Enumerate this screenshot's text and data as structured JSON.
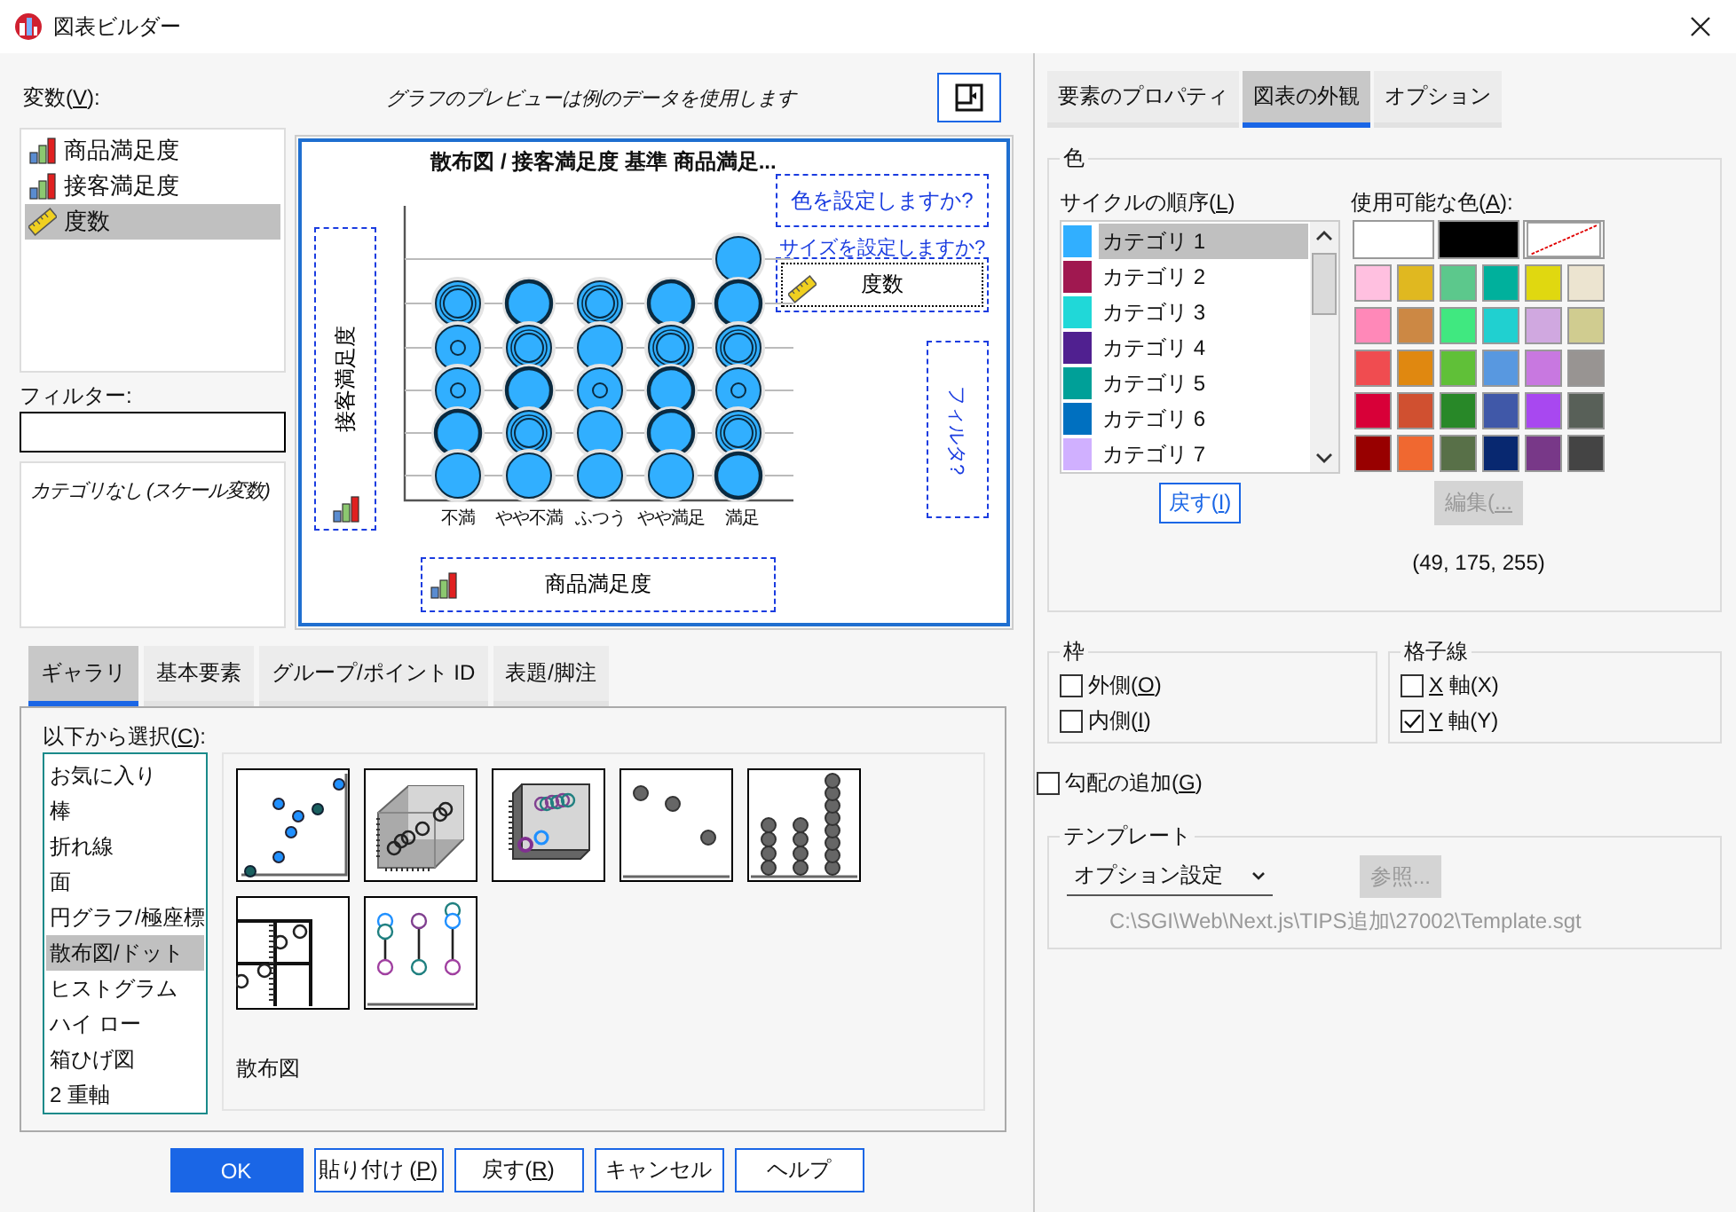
{
  "window": {
    "title": "図表ビルダー"
  },
  "variables": {
    "label": {
      "pre": "変数(",
      "key": "V",
      "post": "):"
    },
    "items": [
      {
        "name": "商品満足度",
        "kind": "ordinal",
        "selected": false
      },
      {
        "name": "接客満足度",
        "kind": "ordinal",
        "selected": false
      },
      {
        "name": "度数",
        "kind": "scale",
        "selected": true
      }
    ]
  },
  "preview_note": "グラフのプレビューは例のデータを使用します",
  "filter": {
    "label": "フィルター:"
  },
  "category_info": "カテゴリなし (スケール変数)",
  "preview": {
    "title": "散布図 / 接客満足度 基準 商品満足...",
    "y_axis": {
      "label": "接客満足度",
      "kind": "ordinal"
    },
    "x_axis": {
      "label": "商品満足度",
      "kind": "ordinal"
    },
    "x_labels": [
      "不満",
      "やや不満",
      "ふつう",
      "やや満足",
      "満足"
    ],
    "color_zone": "色を設定しますか?",
    "size_prompt": "サイズを設定しますか?",
    "size_zone": {
      "label": "度数",
      "kind": "scale"
    },
    "filter_zone": "フィルタ?"
  },
  "gallery_tabs": [
    {
      "label": "ギャラリ",
      "selected": true
    },
    {
      "label": "基本要素",
      "selected": false
    },
    {
      "label": "グループ/ポイント ID",
      "selected": false
    },
    {
      "label": "表題/脚注",
      "selected": false
    }
  ],
  "gallery": {
    "label": {
      "pre": "以下から選択(",
      "key": "C",
      "post": "):"
    },
    "types": [
      {
        "label": "お気に入り",
        "selected": false
      },
      {
        "label": "棒",
        "selected": false
      },
      {
        "label": "折れ線",
        "selected": false
      },
      {
        "label": "面",
        "selected": false
      },
      {
        "label": "円グラフ/極座標",
        "selected": false
      },
      {
        "label": "散布図/ドット",
        "selected": true
      },
      {
        "label": "ヒストグラム",
        "selected": false
      },
      {
        "label": "ハイ ロー",
        "selected": false
      },
      {
        "label": "箱ひげ図",
        "selected": false
      },
      {
        "label": "2 重軸",
        "selected": false
      }
    ],
    "thumbnails": [
      {
        "kind": "scatter"
      },
      {
        "kind": "scatter3d"
      },
      {
        "kind": "grouped3d"
      },
      {
        "kind": "dot"
      },
      {
        "kind": "dotstack"
      },
      {
        "kind": "matrix"
      },
      {
        "kind": "dropline"
      }
    ],
    "caption": "散布図"
  },
  "buttons": [
    {
      "label": "OK",
      "kind": "default"
    },
    {
      "label": {
        "pre": "貼り付け (",
        "key": "P",
        "post": ")"
      },
      "kind": "normal"
    },
    {
      "label": {
        "pre": "戻す(",
        "key": "R",
        "post": ")"
      },
      "kind": "normal"
    },
    {
      "label": "キャンセル",
      "kind": "normal"
    },
    {
      "label": "ヘルプ",
      "kind": "normal"
    }
  ],
  "side_tabs": [
    {
      "label": "要素のプロパティ",
      "selected": false
    },
    {
      "label": "図表の外観",
      "selected": true
    },
    {
      "label": "オプション",
      "selected": false
    }
  ],
  "color_group": {
    "title": "色",
    "cycle_label": {
      "pre": "サイクルの順序(",
      "key": "L",
      "post": ")"
    },
    "cycle": [
      {
        "name": "カテゴリ 1",
        "color": "#31afff",
        "selected": true
      },
      {
        "name": "カテゴリ 2",
        "color": "#a01850",
        "selected": false
      },
      {
        "name": "カテゴリ 3",
        "color": "#20d8d8",
        "selected": false
      },
      {
        "name": "カテゴリ 4",
        "color": "#502090",
        "selected": false
      },
      {
        "name": "カテゴリ 5",
        "color": "#00a098",
        "selected": false
      },
      {
        "name": "カテゴリ 6",
        "color": "#0070c0",
        "selected": false
      },
      {
        "name": "カテゴリ 7",
        "color": "#d0b0ff",
        "selected": false
      }
    ],
    "reset_button": {
      "pre": "戻す(",
      "key": "I",
      "post": ")"
    },
    "palette_label": {
      "pre": "使用可能な色(",
      "key": "A",
      "post": "):"
    },
    "palette_top": [
      {
        "kind": "color",
        "color": "#ffffff"
      },
      {
        "kind": "color",
        "color": "#000000"
      },
      {
        "kind": "none"
      }
    ],
    "palette": [
      {
        "color": "#ffc0e0"
      },
      {
        "color": "#e0b820"
      },
      {
        "color": "#5cc88c"
      },
      {
        "color": "#00b09c"
      },
      {
        "color": "#e0d810"
      },
      {
        "color": "#ece4d0"
      },
      {
        "color": "#ff88b8"
      },
      {
        "color": "#cc8844"
      },
      {
        "color": "#40e880"
      },
      {
        "color": "#20d0d0"
      },
      {
        "color": "#d0a8e0"
      },
      {
        "color": "#d0cc90"
      },
      {
        "color": "#f04c50"
      },
      {
        "color": "#e08810"
      },
      {
        "color": "#60c038"
      },
      {
        "color": "#5898e0"
      },
      {
        "color": "#c878e0"
      },
      {
        "color": "#989492"
      },
      {
        "color": "#d80038"
      },
      {
        "color": "#d05030"
      },
      {
        "color": "#288828"
      },
      {
        "color": "#4058a8"
      },
      {
        "color": "#a848f0"
      },
      {
        "color": "#586058"
      },
      {
        "color": "#980000"
      },
      {
        "color": "#f06830"
      },
      {
        "color": "#587048"
      },
      {
        "color": "#082870"
      },
      {
        "color": "#783888"
      },
      {
        "color": "#444444"
      }
    ],
    "edit_button": {
      "label": {
        "pre": "編集(",
        "key": "..."
      },
      "disabled": true
    },
    "current_rgb": "(49, 175, 255)"
  },
  "frame_group": {
    "title": "枠",
    "options": [
      {
        "label": {
          "pre": "外側(",
          "key": "O",
          "post": ")"
        },
        "checked": false
      },
      {
        "label": {
          "pre": "内側(",
          "key": "I",
          "post": ")"
        },
        "checked": false
      }
    ]
  },
  "grid_group": {
    "title": "格子線",
    "options": [
      {
        "label": {
          "key": "X",
          "post": " 軸(X)"
        },
        "checked": false
      },
      {
        "label": {
          "key": "Y",
          "post": " 軸(Y)"
        },
        "checked": true
      }
    ]
  },
  "gradient": {
    "label": {
      "pre": "勾配の追加(",
      "key": "G",
      "post": ")"
    },
    "checked": false
  },
  "template": {
    "title": "テンプレート",
    "dropdown": "オプション設定",
    "browse_button": {
      "label": "参照...",
      "disabled": true
    },
    "path": "C:\\SGI\\Web\\Next.js\\TIPS追加\\27002\\Template.sgt"
  }
}
